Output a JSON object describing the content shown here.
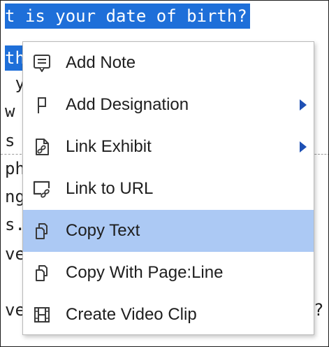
{
  "transcript": {
    "lines": [
      "t is your date of birth?",
      "th",
      " y",
      "w",
      "s",
      "ph",
      "ng",
      "s.",
      "ve",
      "",
      "ve"
    ],
    "trailing_text": "?"
  },
  "context_menu": {
    "items": [
      {
        "label": "Add Note",
        "icon": "note-icon",
        "has_submenu": false
      },
      {
        "label": "Add Designation",
        "icon": "designation-flag-icon",
        "has_submenu": true
      },
      {
        "label": "Link Exhibit",
        "icon": "link-exhibit-icon",
        "has_submenu": true
      },
      {
        "label": "Link to URL",
        "icon": "link-url-icon",
        "has_submenu": false
      },
      {
        "label": "Copy Text",
        "icon": "copy-icon",
        "has_submenu": false,
        "highlighted": true
      },
      {
        "label": "Copy With Page:Line",
        "icon": "copy-icon",
        "has_submenu": false
      },
      {
        "label": "Create Video Clip",
        "icon": "film-icon",
        "has_submenu": false
      }
    ],
    "highlight_color": "#acc9f4",
    "submenu_arrow_color": "#1e50b4"
  },
  "selection_color": "#1e6fd9"
}
